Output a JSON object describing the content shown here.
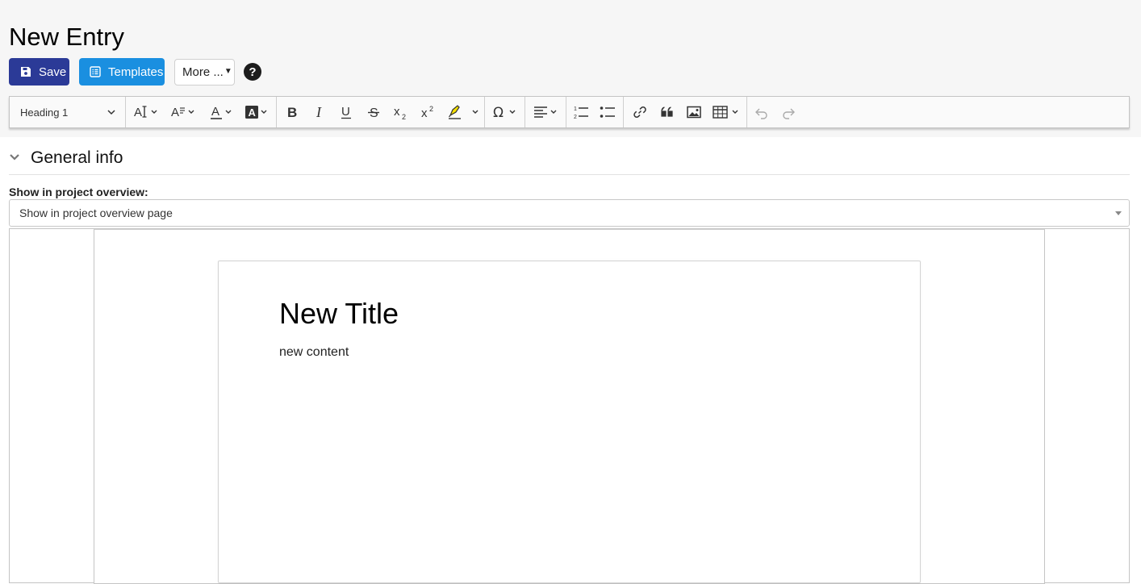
{
  "page": {
    "title": "New Entry"
  },
  "actions": {
    "save_label": "Save",
    "templates_label": "Templates",
    "more_label": "More ...",
    "help_symbol": "?"
  },
  "toolbar": {
    "heading_value": "Heading 1",
    "icons": [
      "font-size-icon",
      "font-family-icon",
      "font-color-icon",
      "font-background-color-icon",
      "bold-icon",
      "italic-icon",
      "underline-icon",
      "strikethrough-icon",
      "subscript-icon",
      "superscript-icon",
      "highlight-icon",
      "special-characters-icon",
      "align-icon",
      "numbered-list-icon",
      "bulleted-list-icon",
      "link-icon",
      "blockquote-icon",
      "image-icon",
      "table-icon",
      "undo-icon",
      "redo-icon"
    ]
  },
  "section": {
    "title": "General info"
  },
  "form": {
    "overview_label": "Show in project overview:",
    "overview_value": "Show in project overview page"
  },
  "document": {
    "title": "New Title",
    "body": "new content"
  },
  "colors": {
    "save_button": "#2b3a97",
    "templates_button": "#1a8fe0",
    "top_background": "#f6f6f6"
  }
}
